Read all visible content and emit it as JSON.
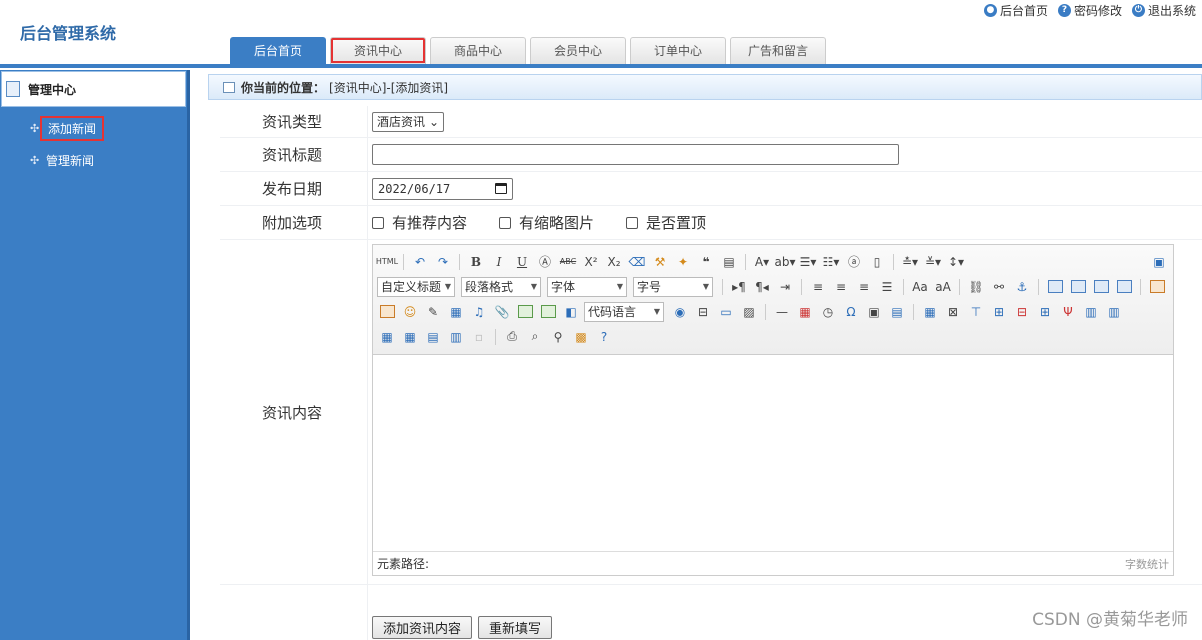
{
  "header": {
    "logo": "后台管理系统",
    "toplinks": [
      {
        "label": "后台首页",
        "icon": "user-icon"
      },
      {
        "label": "密码修改",
        "icon": "help-icon"
      },
      {
        "label": "退出系统",
        "icon": "power-icon"
      }
    ],
    "nav": [
      "后台首页",
      "资讯中心",
      "商品中心",
      "会员中心",
      "订单中心",
      "广告和留言"
    ],
    "active_nav": "后台首页",
    "highlighted_nav": "资讯中心"
  },
  "sidebar": {
    "title": "管理中心",
    "items": [
      {
        "label": "添加新闻",
        "highlighted": true
      },
      {
        "label": "管理新闻",
        "highlighted": false
      }
    ]
  },
  "breadcrumb": {
    "prefix": "你当前的位置：",
    "path": "[资讯中心]-[添加资讯]"
  },
  "form": {
    "type_label": "资讯类型",
    "type_value": "酒店资讯",
    "title_label": "资讯标题",
    "title_value": "",
    "date_label": "发布日期",
    "date_value": "2022/06/17",
    "options_label": "附加选项",
    "options": [
      "有推荐内容",
      "有缩略图片",
      "是否置顶"
    ],
    "content_label": "资讯内容"
  },
  "editor": {
    "html_label": "HTML",
    "heading_select": "自定义标题",
    "paragraph_select": "段落格式",
    "font_select": "字体",
    "size_select": "字号",
    "code_select": "代码语言",
    "status_path": "元素路径:",
    "word_count": "字数统计"
  },
  "buttons": {
    "submit": "添加资讯内容",
    "reset": "重新填写"
  },
  "watermark": "CSDN @黄菊华老师",
  "colors": {
    "primary": "#3b7ec5",
    "highlight": "#e53333"
  }
}
